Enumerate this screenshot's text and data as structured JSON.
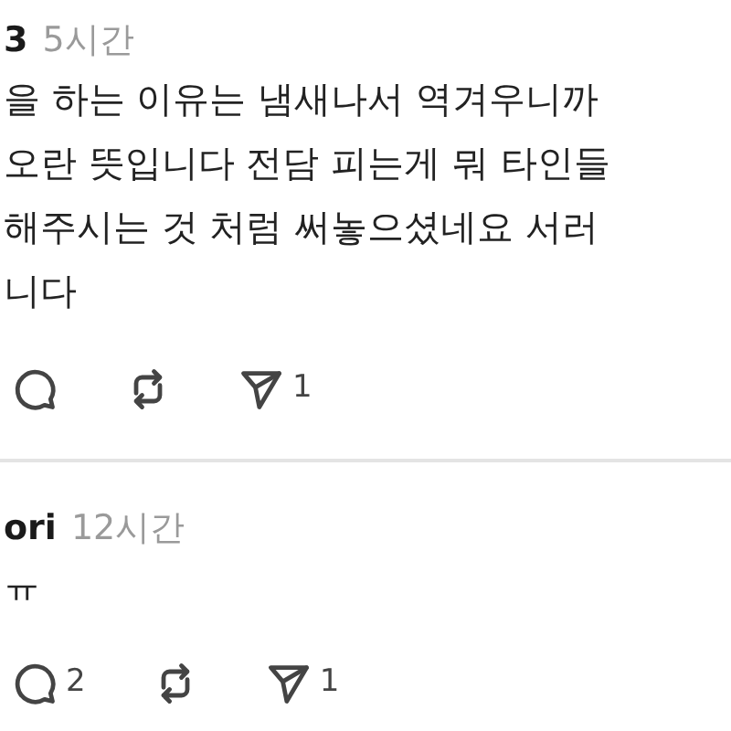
{
  "comments": [
    {
      "author": "3",
      "time": "5시간",
      "body_lines": [
        "을 하는 이유는 냄새나서 역겨우니까",
        "오란 뜻입니다 전담 피는게 뭐 타인들",
        "해주시는 것 처럼 써놓으셨네요 서러",
        "니다"
      ],
      "send_count": "1"
    },
    {
      "author": "ori",
      "time": "12시간",
      "body_lines": [
        "ㅠ"
      ],
      "reply_count": "2",
      "send_count": "1"
    }
  ]
}
